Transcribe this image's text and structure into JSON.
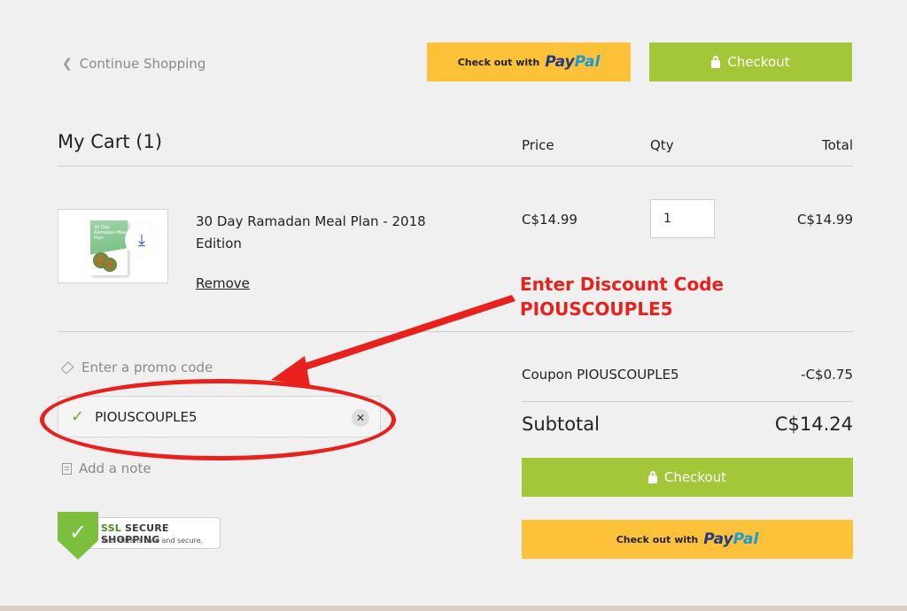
{
  "nav": {
    "continue_label": "Continue Shopping",
    "chevron_icon": "chevron-left-icon"
  },
  "top_buttons": {
    "paypal_prefix": "Check out with",
    "paypal_brand_1": "Pay",
    "paypal_brand_2": "Pal",
    "checkout_label": "Checkout"
  },
  "cart": {
    "title": "My Cart (1)",
    "columns": {
      "price": "Price",
      "qty": "Qty",
      "total": "Total"
    }
  },
  "item": {
    "name": "30 Day Ramadan Meal Plan - 2018 Edition",
    "thumb_title": "30 Day Ramadan Meal Plan",
    "remove_label": "Remove",
    "price": "C$14.99",
    "qty": "1",
    "total": "C$14.99",
    "download_icon": "download-icon"
  },
  "annotation": {
    "line1": "Enter Discount Code",
    "line2": "PIOUSCOUPLE5"
  },
  "promo": {
    "label": "Enter a promo code",
    "code": "PIOUSCOUPLE5",
    "clear_icon": "close-icon"
  },
  "note": {
    "label": "Add a note"
  },
  "ssl": {
    "title_ssl": "SSL",
    "title_rest": "SECURE SHOPPING",
    "subtitle": "Your data is safe and secure."
  },
  "summary": {
    "coupon_label": "Coupon PIOUSCOUPLE5",
    "coupon_value": "-C$0.75",
    "subtotal_label": "Subtotal",
    "subtotal_value": "C$14.24",
    "checkout_label": "Checkout",
    "paypal_prefix": "Check out with",
    "paypal_brand_1": "Pay",
    "paypal_brand_2": "Pal"
  },
  "colors": {
    "accent_green": "#a4c639",
    "paypal_yellow": "#fec13a",
    "annotation_red": "#e8211d",
    "check_green": "#5cb53a"
  }
}
